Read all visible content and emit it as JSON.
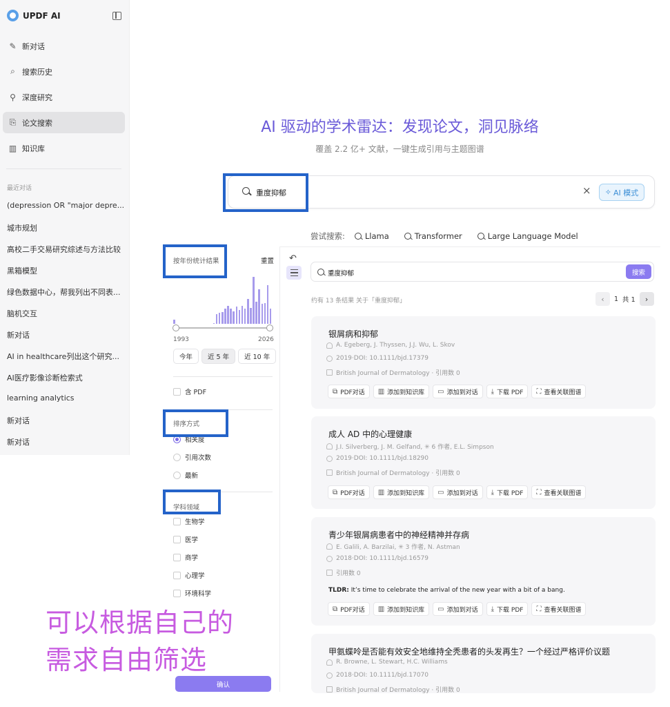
{
  "app": {
    "name": "UPDF AI"
  },
  "sidebar": {
    "nav": [
      {
        "label": "新对话",
        "icon": "edit-icon"
      },
      {
        "label": "搜索历史",
        "icon": "search-icon"
      },
      {
        "label": "深度研究",
        "icon": "telescope-icon"
      },
      {
        "label": "论文搜索",
        "icon": "paper-search-icon",
        "active": true
      },
      {
        "label": "知识库",
        "icon": "library-icon"
      }
    ],
    "recent_title": "最近对话",
    "recent": [
      "(depression OR \"major depre...",
      "城市规划",
      "高校二手交易研究综述与方法比较",
      "黑箱模型",
      "绿色数据中心，帮我列出不同表...",
      "脑机交互",
      "新对话",
      "AI in healthcare列出这个研究...",
      "AI医疗影像诊断检索式",
      "learning analytics",
      "新对话",
      "新对话"
    ]
  },
  "hero": {
    "title": "AI 驱动的学术雷达：发现论文，洞见脉络",
    "subtitle": "覆盖 2.2 亿+ 文献，一键生成引用与主题图谱"
  },
  "search": {
    "query": "重度抑郁",
    "clear": "×",
    "ai_mode": "AI 模式"
  },
  "try_search": {
    "label": "尝试搜索:",
    "items": [
      "Llama",
      "Transformer",
      "Large Language Model"
    ]
  },
  "filters": {
    "year_title": "按年份统计结果",
    "reset": "重置",
    "histogram": [
      0.08,
      0,
      0,
      0,
      0,
      0,
      0,
      0,
      0,
      0,
      0,
      0,
      0,
      0,
      0.02,
      0.2,
      0.22,
      0.24,
      0.3,
      0.36,
      0.3,
      0.25,
      0.35,
      0.28,
      0.36,
      0.3,
      0.5,
      0.32,
      0.95,
      0.45,
      0.7,
      0.4,
      0.42,
      0.78,
      0.3
    ],
    "year_min": "1993",
    "year_max": "2026",
    "year_range_selected": [
      0,
      1
    ],
    "quick": [
      {
        "label": "今年",
        "on": false
      },
      {
        "label": "近 5 年",
        "on": true
      },
      {
        "label": "近 10 年",
        "on": false
      }
    ],
    "has_pdf": "含 PDF",
    "sort_title": "排序方式",
    "sort_options": [
      {
        "label": "相关度",
        "selected": true
      },
      {
        "label": "引用次数",
        "selected": false
      },
      {
        "label": "最新",
        "selected": false
      }
    ],
    "field_title": "学科领域",
    "fields": [
      "生物学",
      "医学",
      "商学",
      "心理学",
      "环境科学"
    ],
    "confirm": "确认"
  },
  "results": {
    "query": "重度抑郁",
    "search_button": "搜索",
    "count_text": "约有 13 条结果 关于「重度抑郁」",
    "page": "1",
    "total": "共 1",
    "prev": "‹",
    "next": "›",
    "action_labels": [
      "PDF对话",
      "添加到知识库",
      "添加到对话",
      "下载 PDF",
      "查看关联图谱"
    ],
    "cards": [
      {
        "title": "银屑病和抑郁",
        "authors": "A. Egeberg, J. Thyssen, J.J. Wu, L. Skov",
        "doi": "2019·DOI: 10.1111/bjd.17379",
        "journal": "British Journal of Dermatology · 引用数 0",
        "tldr_label": "",
        "tldr": ""
      },
      {
        "title": "成人 AD 中的心理健康",
        "authors": "J.I. Silverberg, J. M. Gelfand, ✳ 6 作者, E.L. Simpson",
        "doi": "2019·DOI: 10.1111/bjd.18290",
        "journal": "British Journal of Dermatology · 引用数 0",
        "tldr_label": "",
        "tldr": ""
      },
      {
        "title": "青少年银屑病患者中的神经精神并存病",
        "authors": "E. Galili, A. Barzilai, ✳ 3 作者, N. Astman",
        "doi": "2018·DOI: 10.1111/bjd.16579",
        "journal": "引用数 0",
        "tldr_label": "TLDR:",
        "tldr": " It’s time to celebrate the arrival of the new year with a bit of a bang."
      },
      {
        "title": "甲氨蝶呤是否能有效安全地维持全秃患者的头发再生？一个经过严格评价议题",
        "authors": "R. Browne, L. Stewart, H.C. Williams",
        "doi": "2018·DOI: 10.1111/bjd.17070",
        "journal": "British Journal of Dermatology · 引用数 0",
        "tldr_label": "",
        "tldr": ""
      }
    ]
  },
  "annotation": {
    "line1": "可以根据自己的",
    "line2": "需求自由筛选"
  },
  "colors": {
    "accent": "#8b7bf0",
    "hero_title": "#6a5ad8",
    "highlight_border": "#2463c9",
    "annotation_text": "#c75be0"
  }
}
